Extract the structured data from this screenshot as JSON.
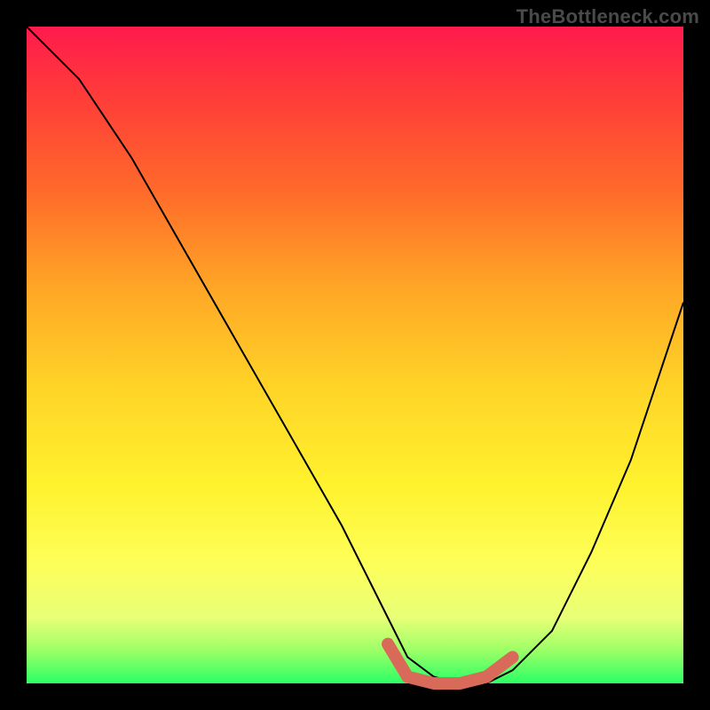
{
  "watermark": "TheBottleneck.com",
  "chart_data": {
    "type": "line",
    "title": "",
    "xlabel": "",
    "ylabel": "",
    "xlim": [
      0,
      100
    ],
    "ylim": [
      0,
      100
    ],
    "grid": false,
    "background": "rainbow-gradient",
    "series": [
      {
        "name": "bottleneck-curve",
        "x": [
          0,
          8,
          16,
          24,
          32,
          40,
          48,
          55,
          58,
          62,
          66,
          70,
          74,
          80,
          86,
          92,
          100
        ],
        "y": [
          100,
          92,
          80,
          66,
          52,
          38,
          24,
          10,
          4,
          1,
          0,
          0,
          2,
          8,
          20,
          34,
          58
        ]
      }
    ],
    "highlight": {
      "name": "optimal-range",
      "x": [
        55,
        58,
        62,
        66,
        70,
        74
      ],
      "y": [
        6,
        1,
        0,
        0,
        1,
        4
      ],
      "color": "#d96a5a"
    }
  }
}
